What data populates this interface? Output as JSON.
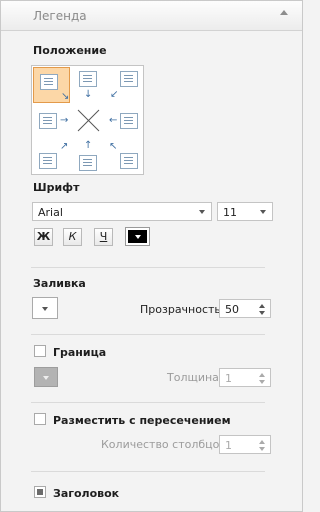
{
  "header": {
    "title": "Легенда"
  },
  "position": {
    "label": "Положение",
    "selected": "top-left"
  },
  "font": {
    "label": "Шрифт",
    "family": "Arial",
    "size": "11",
    "bold": "Ж",
    "italic": "К",
    "underline": "Ч"
  },
  "fill": {
    "label": "Заливка",
    "transparency_label": "Прозрачность",
    "transparency_value": "50"
  },
  "border": {
    "label": "Граница",
    "thickness_label": "Толщина",
    "thickness_value": "1"
  },
  "overlap": {
    "label": "Разместить с пересечением",
    "columns_label": "Количество столбцов",
    "columns_value": "1"
  },
  "title_option": {
    "label": "Заголовок"
  }
}
